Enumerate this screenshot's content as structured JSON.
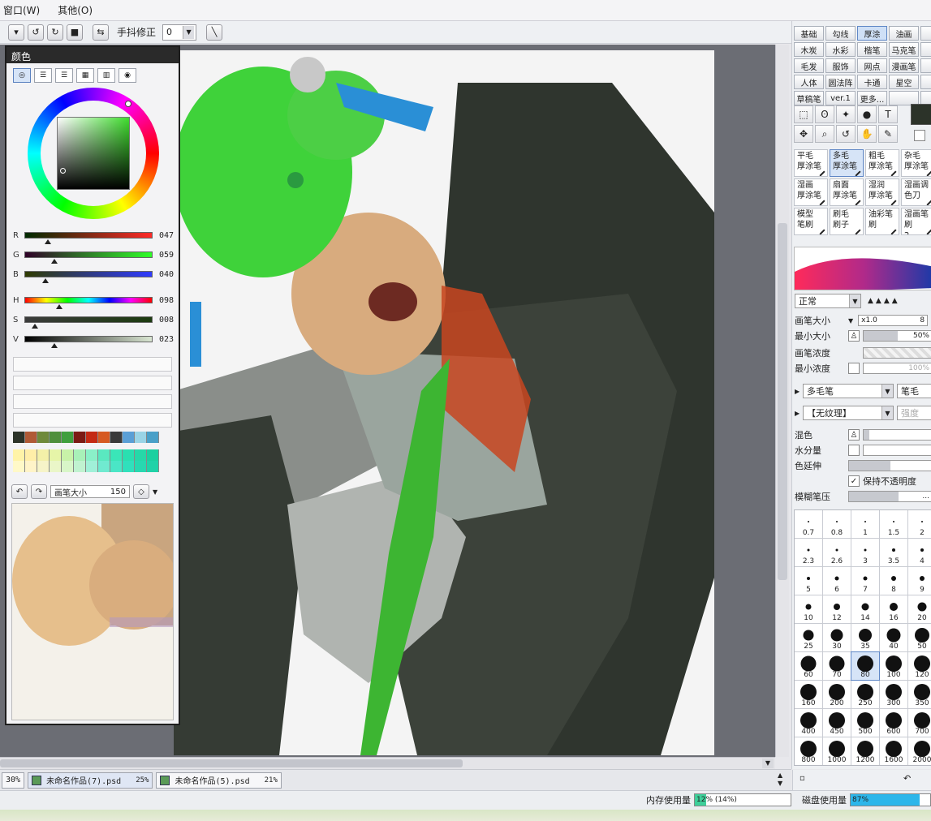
{
  "menu": {
    "items": [
      "窗口(W)",
      "其他(O)"
    ]
  },
  "toolbar": {
    "stabilizer_label": "手抖修正",
    "stabilizer_value": "0"
  },
  "color_panel": {
    "title": "颜色",
    "sliders": [
      {
        "label": "R",
        "value": "047",
        "fraction": 0.18,
        "gradient": "linear-gradient(90deg,#002a00,#ff2a28)"
      },
      {
        "label": "G",
        "value": "059",
        "fraction": 0.23,
        "gradient": "linear-gradient(90deg,#2f0028,#2fff28)"
      },
      {
        "label": "B",
        "value": "040",
        "fraction": 0.16,
        "gradient": "linear-gradient(90deg,#2f3b00,#2f3bff)"
      },
      {
        "label": "H",
        "value": "098",
        "fraction": 0.27,
        "gradient": "linear-gradient(90deg,#f00,#ff0,#0f0,#0ff,#00f,#f0f,#f00)"
      },
      {
        "label": "S",
        "value": "008",
        "fraction": 0.08,
        "gradient": "linear-gradient(90deg,#3b3b3b,#1c3b10)"
      },
      {
        "label": "V",
        "value": "023",
        "fraction": 0.23,
        "gradient": "linear-gradient(90deg,#000,#d9e6d2)"
      }
    ],
    "swatches_row1": [
      "#2c3329",
      "#b05a36",
      "#6f8a3a",
      "#4f8f3c",
      "#3f9f3d",
      "#7b1a14",
      "#c42a14",
      "#d65a22",
      "#3a3a3a",
      "#5a9fd6",
      "#9ad4e6",
      "#4aa0c8"
    ],
    "swatches_row2": [
      "#fff3a8",
      "#ffeea8",
      "#f3f0a8",
      "#e6f5a8",
      "#c8f2a8",
      "#a8f0b8",
      "#8af0c8",
      "#5ae8c0",
      "#3ae6b8",
      "#2adfb0",
      "#26d8a8",
      "#1ad0a0"
    ],
    "swatches_row3": [
      "#fff9c8",
      "#fff4c8",
      "#f6f4c8",
      "#eaf6c8",
      "#d8f6c8",
      "#c0f2d0",
      "#a0f0d8",
      "#70ead0",
      "#4ae6c6",
      "#30e0bc",
      "#28d8b0",
      "#20d2a8"
    ],
    "brush_size_label": "画笔大小",
    "brush_size_value": "150"
  },
  "right_panel": {
    "categories": [
      "基础",
      "勾线",
      "厚涂",
      "油画",
      "二",
      "木炭",
      "水彩",
      "楷笔",
      "马克笔",
      "铅",
      "毛发",
      "服饰",
      "网点",
      "漫画笔",
      "",
      "人体",
      "圆法阵",
      "卡通",
      "星空",
      "",
      "草稿笔",
      "ver.1",
      "更多...",
      "",
      ""
    ],
    "active_category": "厚涂",
    "brushes": [
      {
        "line1": "平毛",
        "line2": "厚涂笔"
      },
      {
        "line1": "多毛",
        "line2": "厚涂笔"
      },
      {
        "line1": "粗毛",
        "line2": "厚涂笔"
      },
      {
        "line1": "杂毛",
        "line2": "厚涂笔"
      },
      {
        "line1": "",
        "line2": ""
      },
      {
        "line1": "湿画",
        "line2": "厚涂笔"
      },
      {
        "line1": "扇面",
        "line2": "厚涂笔"
      },
      {
        "line1": "湿润",
        "line2": "厚涂笔"
      },
      {
        "line1": "湿画调",
        "line2": "色刀"
      },
      {
        "line1": "",
        "line2": ""
      },
      {
        "line1": "模型",
        "line2": "笔刷"
      },
      {
        "line1": "刷毛",
        "line2": "刷子"
      },
      {
        "line1": "油彩笔刷",
        "line2": ""
      },
      {
        "line1": "湿画笔刷",
        "line2": "2"
      },
      {
        "line1": "",
        "line2": ""
      }
    ],
    "active_brush": 1,
    "blend_mode": "正常",
    "props": {
      "brush_size_label": "画笔大小",
      "brush_size_mult": "x1.0",
      "brush_size_val": "8",
      "min_size_label": "最小大小",
      "min_size_val": "50%",
      "min_size_fraction": 0.5,
      "density_label": "画笔浓度",
      "min_density_label": "最小浓度",
      "min_density_val": "100%"
    },
    "shape_select": "多毛笔",
    "shape_alt": "笔毛",
    "texture_select": "【无纹理】",
    "texture_alt": "强度",
    "mix_label": "混色",
    "water_label": "水分量",
    "extend_label": "色延伸",
    "keep_opacity_label": "保持不透明度",
    "blur_label": "模糊笔压",
    "blur_val": "...",
    "sizes": [
      {
        "n": "0.7",
        "d": 2
      },
      {
        "n": "0.8",
        "d": 2
      },
      {
        "n": "1",
        "d": 2
      },
      {
        "n": "1.5",
        "d": 2
      },
      {
        "n": "2",
        "d": 2
      },
      {
        "n": "2.3",
        "d": 3
      },
      {
        "n": "2.6",
        "d": 3
      },
      {
        "n": "3",
        "d": 3
      },
      {
        "n": "3.5",
        "d": 4
      },
      {
        "n": "4",
        "d": 4
      },
      {
        "n": "5",
        "d": 4
      },
      {
        "n": "6",
        "d": 5
      },
      {
        "n": "7",
        "d": 5
      },
      {
        "n": "8",
        "d": 6
      },
      {
        "n": "9",
        "d": 6
      },
      {
        "n": "10",
        "d": 7
      },
      {
        "n": "12",
        "d": 8
      },
      {
        "n": "14",
        "d": 9
      },
      {
        "n": "16",
        "d": 10
      },
      {
        "n": "20",
        "d": 11
      },
      {
        "n": "25",
        "d": 13
      },
      {
        "n": "30",
        "d": 15
      },
      {
        "n": "35",
        "d": 16
      },
      {
        "n": "40",
        "d": 17
      },
      {
        "n": "50",
        "d": 18
      },
      {
        "n": "60",
        "d": 19
      },
      {
        "n": "70",
        "d": 19
      },
      {
        "n": "80",
        "d": 20
      },
      {
        "n": "100",
        "d": 20
      },
      {
        "n": "120",
        "d": 20
      },
      {
        "n": "160",
        "d": 20
      },
      {
        "n": "200",
        "d": 20
      },
      {
        "n": "250",
        "d": 20
      },
      {
        "n": "300",
        "d": 20
      },
      {
        "n": "350",
        "d": 20
      },
      {
        "n": "400",
        "d": 20
      },
      {
        "n": "450",
        "d": 20
      },
      {
        "n": "500",
        "d": 20
      },
      {
        "n": "600",
        "d": 20
      },
      {
        "n": "700",
        "d": 20
      },
      {
        "n": "800",
        "d": 20
      },
      {
        "n": "1000",
        "d": 20
      },
      {
        "n": "1200",
        "d": 20
      },
      {
        "n": "1600",
        "d": 20
      },
      {
        "n": "2000",
        "d": 20
      }
    ],
    "active_size": "80"
  },
  "tabs": {
    "zoom": "30%",
    "docs": [
      {
        "name": "未命名作品(7).psd",
        "pct": "25%",
        "active": true
      },
      {
        "name": "未命名作品(5).psd",
        "pct": "21%",
        "active": false
      }
    ]
  },
  "status": {
    "mem_label": "内存使用量",
    "mem_value": "12% (14%)",
    "mem_fraction": 0.12,
    "disk_label": "磁盘使用量",
    "disk_value": "87%",
    "disk_fraction": 0.87
  }
}
